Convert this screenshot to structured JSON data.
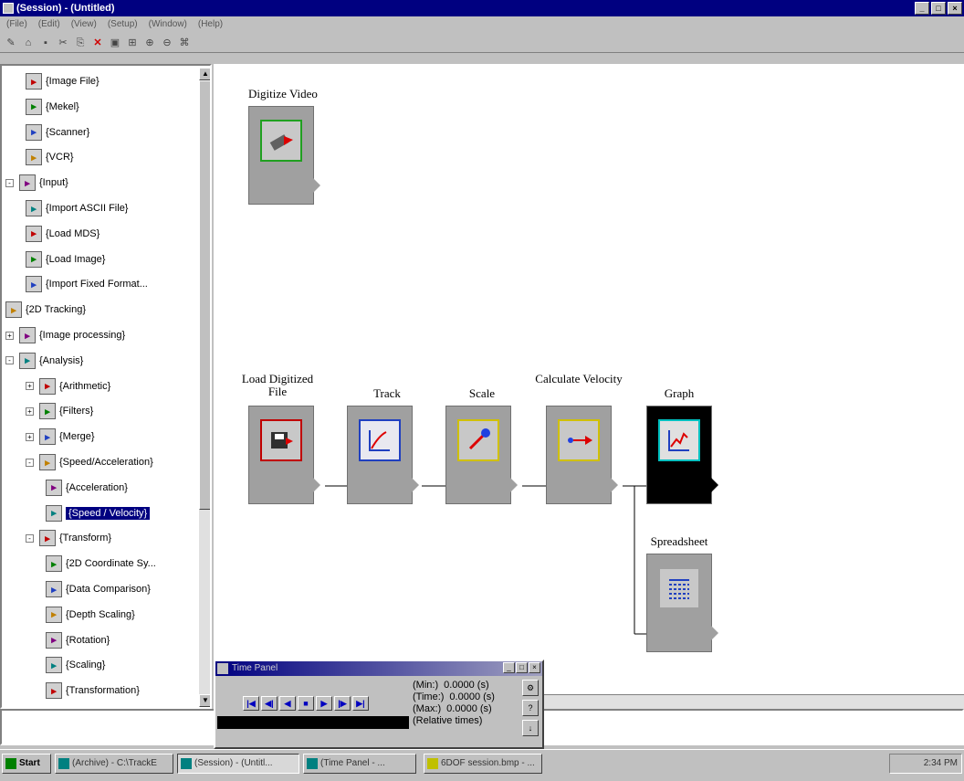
{
  "window": {
    "title": "(Session) - (Untitled)"
  },
  "menu": [
    "(File)",
    "(Edit)",
    "(View)",
    "(Setup)",
    "(Window)",
    "(Help)"
  ],
  "tree": {
    "items": [
      {
        "label": "{Image File}",
        "indent": 2,
        "icon": "image-file-icon"
      },
      {
        "label": "{Mekel}",
        "indent": 2,
        "icon": "mekel-icon"
      },
      {
        "label": "{Scanner}",
        "indent": 2,
        "icon": "scanner-icon"
      },
      {
        "label": "{VCR}",
        "indent": 2,
        "icon": "vcr-icon"
      },
      {
        "label": "{Input}",
        "indent": 1,
        "icon": "input-icon",
        "expander": "-"
      },
      {
        "label": "{Import ASCII File}",
        "indent": 2,
        "icon": "import-ascii-icon"
      },
      {
        "label": "{Load MDS}",
        "indent": 2,
        "icon": "load-mds-icon"
      },
      {
        "label": "{Load Image}",
        "indent": 2,
        "icon": "load-image-icon"
      },
      {
        "label": "{Import Fixed Format...",
        "indent": 2,
        "icon": "import-fixed-icon"
      },
      {
        "label": "{2D Tracking}",
        "indent": 1,
        "icon": "tracking-icon"
      },
      {
        "label": "{Image processing}",
        "indent": 1,
        "icon": "image-processing-icon",
        "expander": "+"
      },
      {
        "label": "{Analysis}",
        "indent": 1,
        "icon": "analysis-icon",
        "expander": "-"
      },
      {
        "label": "{Arithmetic}",
        "indent": 2,
        "icon": "arithmetic-icon",
        "expander": "+"
      },
      {
        "label": "{Filters}",
        "indent": 2,
        "icon": "filters-icon",
        "expander": "+"
      },
      {
        "label": "{Merge}",
        "indent": 2,
        "icon": "merge-icon",
        "expander": "+"
      },
      {
        "label": "{Speed/Acceleration}",
        "indent": 2,
        "icon": "speed-acceleration-icon",
        "expander": "-"
      },
      {
        "label": "{Acceleration}",
        "indent": 3,
        "icon": "acceleration-icon"
      },
      {
        "label": "{Speed / Velocity}",
        "indent": 3,
        "icon": "speed-velocity-icon",
        "selected": true
      },
      {
        "label": "{Transform}",
        "indent": 2,
        "icon": "transform-icon",
        "expander": "-"
      },
      {
        "label": "{2D Coordinate Sy...",
        "indent": 3,
        "icon": "coordinate-icon"
      },
      {
        "label": "{Data Comparison}",
        "indent": 3,
        "icon": "data-comparison-icon"
      },
      {
        "label": "{Depth Scaling}",
        "indent": 3,
        "icon": "depth-scaling-icon"
      },
      {
        "label": "{Rotation}",
        "indent": 3,
        "icon": "rotation-icon"
      },
      {
        "label": "{Scaling}",
        "indent": 3,
        "icon": "scaling-icon"
      },
      {
        "label": "{Transformation}",
        "indent": 3,
        "icon": "transformation-icon"
      }
    ]
  },
  "nodes": {
    "digitize": {
      "label": "Digitize Video",
      "icon": "video-icon"
    },
    "load": {
      "label": "Load Digitized File",
      "icon": "floppy-disk-icon"
    },
    "track": {
      "label": "Track",
      "icon": "track-chart-icon"
    },
    "scale": {
      "label": "Scale",
      "icon": "scale-icon"
    },
    "velocity": {
      "label": "Calculate Velocity",
      "icon": "velocity-arrow-icon"
    },
    "graph": {
      "label": "Graph",
      "icon": "graph-icon"
    },
    "spreadsheet": {
      "label": "Spreadsheet",
      "icon": "spreadsheet-icon"
    }
  },
  "time_panel": {
    "title": "Time Panel",
    "min_label": "(Min:)",
    "min_value": "0.0000 (s)",
    "time_label": "(Time:)",
    "time_value": "0.0000 (s)",
    "max_label": "(Max:)",
    "max_value": "0.0000 (s)",
    "relative": "(Relative times)"
  },
  "taskbar": {
    "start": "Start",
    "tasks": [
      "(Archive) - C:\\TrackE",
      "(Session) - (Untitl...",
      "(Time Panel - ...",
      "6DOF session.bmp - ..."
    ],
    "clock": "2:34 PM"
  },
  "colors": {
    "title": "#000080",
    "selected": "#000080",
    "node": "#a0a0a0"
  }
}
